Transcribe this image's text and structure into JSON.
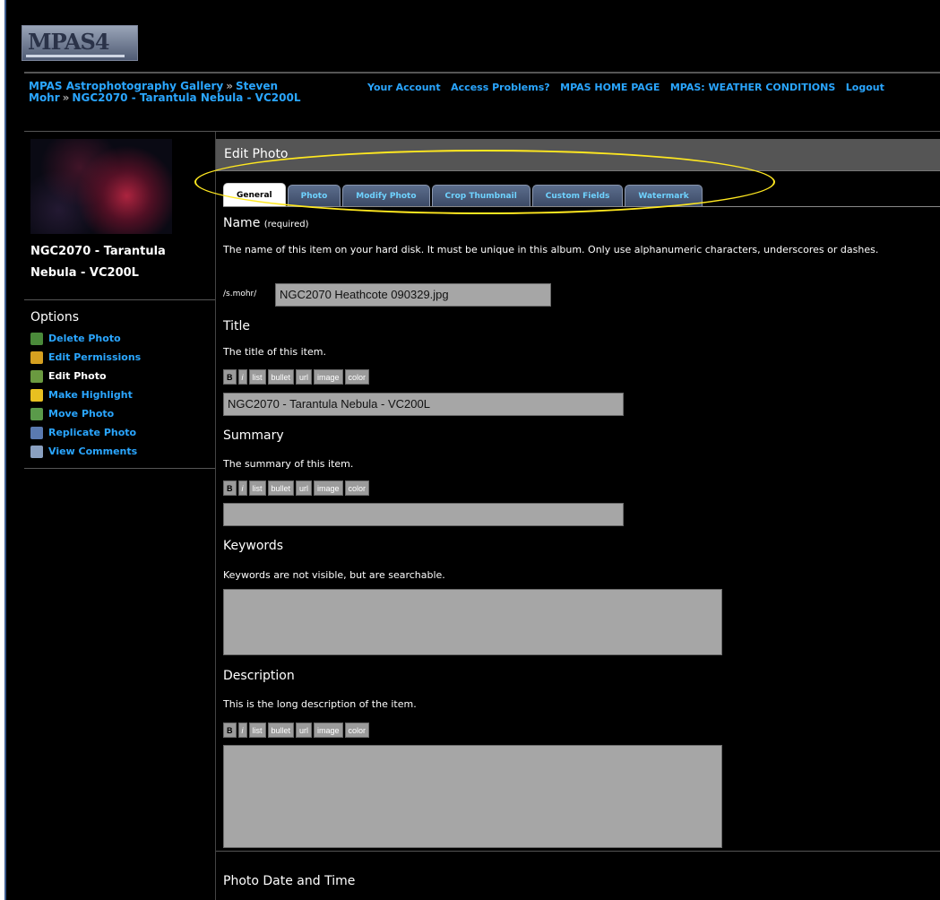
{
  "logo": {
    "text": "MPAS4"
  },
  "breadcrumb": {
    "items": [
      "MPAS Astrophotography Gallery",
      "Steven Mohr",
      "NGC2070 - Tarantula Nebula - VC200L"
    ],
    "separator": "»"
  },
  "toplinks": [
    "Your Account",
    "Access Problems?",
    "MPAS HOME PAGE",
    "MPAS: WEATHER CONDITIONS",
    "Logout"
  ],
  "sidebar": {
    "thumb_title": "NGC2070 - Tarantula Nebula - VC200L",
    "options_title": "Options",
    "options": [
      {
        "label": "Delete Photo",
        "icon": "delete-icon",
        "color": "#4a8a3a"
      },
      {
        "label": "Edit Permissions",
        "icon": "lock-icon",
        "color": "#d6a020"
      },
      {
        "label": "Edit Photo",
        "icon": "edit-icon",
        "color": "#6a9a40",
        "current": true
      },
      {
        "label": "Make Highlight",
        "icon": "lightbulb-icon",
        "color": "#e8c020"
      },
      {
        "label": "Move Photo",
        "icon": "move-icon",
        "color": "#5a9a4a"
      },
      {
        "label": "Replicate Photo",
        "icon": "copy-icon",
        "color": "#5a7ab0"
      },
      {
        "label": "View Comments",
        "icon": "comments-icon",
        "color": "#8aa0c0"
      }
    ]
  },
  "main": {
    "title": "Edit Photo",
    "tabs": [
      "General",
      "Photo",
      "Modify Photo",
      "Crop Thumbnail",
      "Custom Fields",
      "Watermark"
    ],
    "active_tab": "General",
    "name": {
      "label": "Name",
      "required": "(required)",
      "help": "The name of this item on your hard disk. It must be unique in this album. Only use alphanumeric characters, underscores or dashes.",
      "prefix": "/s.mohr/",
      "value": "NGC2070 Heathcote 090329.jpg"
    },
    "title_field": {
      "label": "Title",
      "help": "The title of this item.",
      "value": "NGC2070 - Tarantula Nebula - VC200L"
    },
    "summary": {
      "label": "Summary",
      "help": "The summary of this item.",
      "value": ""
    },
    "keywords": {
      "label": "Keywords",
      "help": "Keywords are not visible, but are searchable.",
      "value": ""
    },
    "description": {
      "label": "Description",
      "help": "This is the long description of the item.",
      "value": ""
    },
    "date_time": {
      "label": "Photo Date and Time"
    },
    "markup_buttons": [
      "B",
      "i",
      "list",
      "bullet",
      "url",
      "image",
      "color"
    ]
  }
}
